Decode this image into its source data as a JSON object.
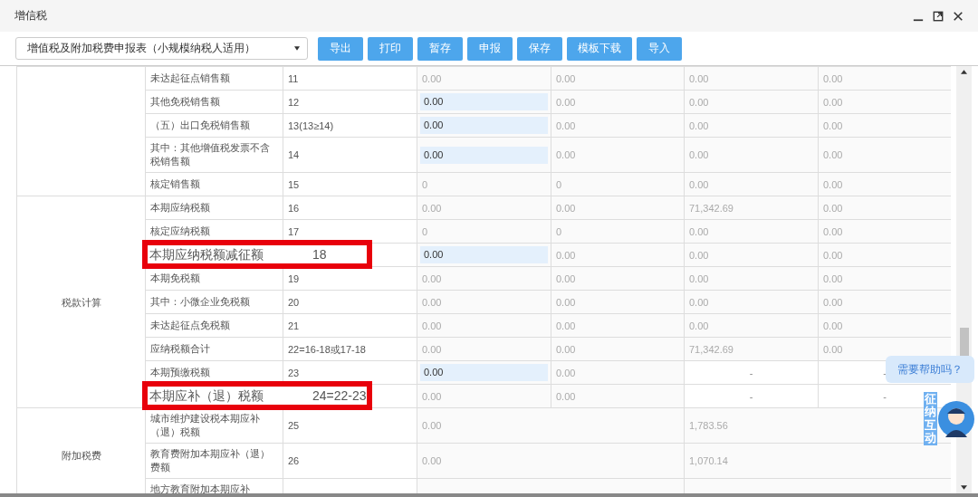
{
  "window": {
    "title": "增信税"
  },
  "toolbar": {
    "form_select": "增值税及附加税费申报表（小规模纳税人适用）",
    "buttons": [
      "导出",
      "打印",
      "暂存",
      "申报",
      "保存",
      "模板下载",
      "导入"
    ]
  },
  "table": {
    "groups": [
      {
        "rows": [
          {
            "item": "未达起征点销售额",
            "line": "11",
            "highlighted": false,
            "values": [
              {
                "text": "0.00",
                "kind": "readonly"
              },
              {
                "text": "0.00",
                "kind": "readonly"
              },
              {
                "text": "0.00",
                "kind": "readonly"
              },
              {
                "text": "0.00",
                "kind": "readonly"
              }
            ]
          },
          {
            "item": "其他免税销售额",
            "line": "12",
            "highlighted": false,
            "values": [
              {
                "text": "0.00",
                "kind": "input"
              },
              {
                "text": "0.00",
                "kind": "readonly"
              },
              {
                "text": "0.00",
                "kind": "readonly"
              },
              {
                "text": "0.00",
                "kind": "readonly"
              }
            ]
          },
          {
            "item": "（五）出口免税销售额",
            "line": "13(13≥14)",
            "highlighted": false,
            "values": [
              {
                "text": "0.00",
                "kind": "input"
              },
              {
                "text": "0.00",
                "kind": "readonly"
              },
              {
                "text": "0.00",
                "kind": "readonly"
              },
              {
                "text": "0.00",
                "kind": "readonly"
              }
            ]
          },
          {
            "item": "其中：其他增值税发票不含税销售额",
            "line": "14",
            "highlighted": false,
            "values": [
              {
                "text": "0.00",
                "kind": "input"
              },
              {
                "text": "0.00",
                "kind": "readonly"
              },
              {
                "text": "0.00",
                "kind": "readonly"
              },
              {
                "text": "0.00",
                "kind": "readonly"
              }
            ]
          },
          {
            "item": "核定销售额",
            "line": "15",
            "highlighted": false,
            "values": [
              {
                "text": "0",
                "kind": "readonly"
              },
              {
                "text": "0",
                "kind": "readonly"
              },
              {
                "text": "0.00",
                "kind": "readonly"
              },
              {
                "text": "0.00",
                "kind": "readonly"
              }
            ]
          }
        ]
      },
      {
        "label": "税款计算",
        "rows": [
          {
            "item": "本期应纳税额",
            "line": "16",
            "highlighted": false,
            "values": [
              {
                "text": "0.00",
                "kind": "readonly"
              },
              {
                "text": "0.00",
                "kind": "readonly"
              },
              {
                "text": "71,342.69",
                "kind": "readonly"
              },
              {
                "text": "0.00",
                "kind": "readonly"
              }
            ]
          },
          {
            "item": "核定应纳税额",
            "line": "17",
            "highlighted": false,
            "values": [
              {
                "text": "0",
                "kind": "readonly"
              },
              {
                "text": "0",
                "kind": "readonly"
              },
              {
                "text": "0.00",
                "kind": "readonly"
              },
              {
                "text": "0.00",
                "kind": "readonly"
              }
            ]
          },
          {
            "item": "本期应纳税额减征额",
            "line": "18",
            "highlighted": true,
            "values": [
              {
                "text": "0.00",
                "kind": "input"
              },
              {
                "text": "0.00",
                "kind": "readonly"
              },
              {
                "text": "0.00",
                "kind": "readonly"
              },
              {
                "text": "0.00",
                "kind": "readonly"
              }
            ]
          },
          {
            "item": "本期免税额",
            "line": "19",
            "highlighted": false,
            "values": [
              {
                "text": "0.00",
                "kind": "readonly"
              },
              {
                "text": "0.00",
                "kind": "readonly"
              },
              {
                "text": "0.00",
                "kind": "readonly"
              },
              {
                "text": "0.00",
                "kind": "readonly"
              }
            ]
          },
          {
            "item": "其中：小微企业免税额",
            "line": "20",
            "highlighted": false,
            "values": [
              {
                "text": "0.00",
                "kind": "readonly"
              },
              {
                "text": "0.00",
                "kind": "readonly"
              },
              {
                "text": "0.00",
                "kind": "readonly"
              },
              {
                "text": "0.00",
                "kind": "readonly"
              }
            ]
          },
          {
            "item": "未达起征点免税额",
            "line": "21",
            "highlighted": false,
            "values": [
              {
                "text": "0.00",
                "kind": "readonly"
              },
              {
                "text": "0.00",
                "kind": "readonly"
              },
              {
                "text": "0.00",
                "kind": "readonly"
              },
              {
                "text": "0.00",
                "kind": "readonly"
              }
            ]
          },
          {
            "item": "应纳税额合计",
            "line": "22=16-18或17-18",
            "highlighted": false,
            "values": [
              {
                "text": "0.00",
                "kind": "readonly"
              },
              {
                "text": "0.00",
                "kind": "readonly"
              },
              {
                "text": "71,342.69",
                "kind": "readonly"
              },
              {
                "text": "0.00",
                "kind": "readonly"
              }
            ]
          },
          {
            "item": "本期预缴税额",
            "line": "23",
            "highlighted": false,
            "values": [
              {
                "text": "0.00",
                "kind": "input"
              },
              {
                "text": "0.00",
                "kind": "readonly"
              },
              {
                "text": "-",
                "kind": "dash"
              },
              {
                "text": "-",
                "kind": "dash"
              }
            ]
          },
          {
            "item": "本期应补（退）税额",
            "line": "24=22-23",
            "highlighted": true,
            "values": [
              {
                "text": "0.00",
                "kind": "readonly"
              },
              {
                "text": "0.00",
                "kind": "readonly"
              },
              {
                "text": "-",
                "kind": "dash"
              },
              {
                "text": "-",
                "kind": "dash"
              }
            ]
          }
        ]
      },
      {
        "label": "附加税费",
        "rows": [
          {
            "item": "城市维护建设税本期应补（退）税额",
            "line": "25",
            "highlighted": false,
            "values": [
              {
                "text": "0.00",
                "kind": "readonly"
              },
              {
                "text": "1,783.56",
                "kind": "readonly"
              }
            ]
          },
          {
            "item": "教育费附加本期应补（退）费额",
            "line": "26",
            "highlighted": false,
            "values": [
              {
                "text": "0.00",
                "kind": "readonly"
              },
              {
                "text": "1,070.14",
                "kind": "readonly"
              }
            ]
          },
          {
            "item": "地方教育附加本期应补",
            "highlighted": false
          }
        ]
      }
    ]
  },
  "help": {
    "bubble": "需要帮助吗？",
    "avatar_caption": "征纳互动"
  }
}
